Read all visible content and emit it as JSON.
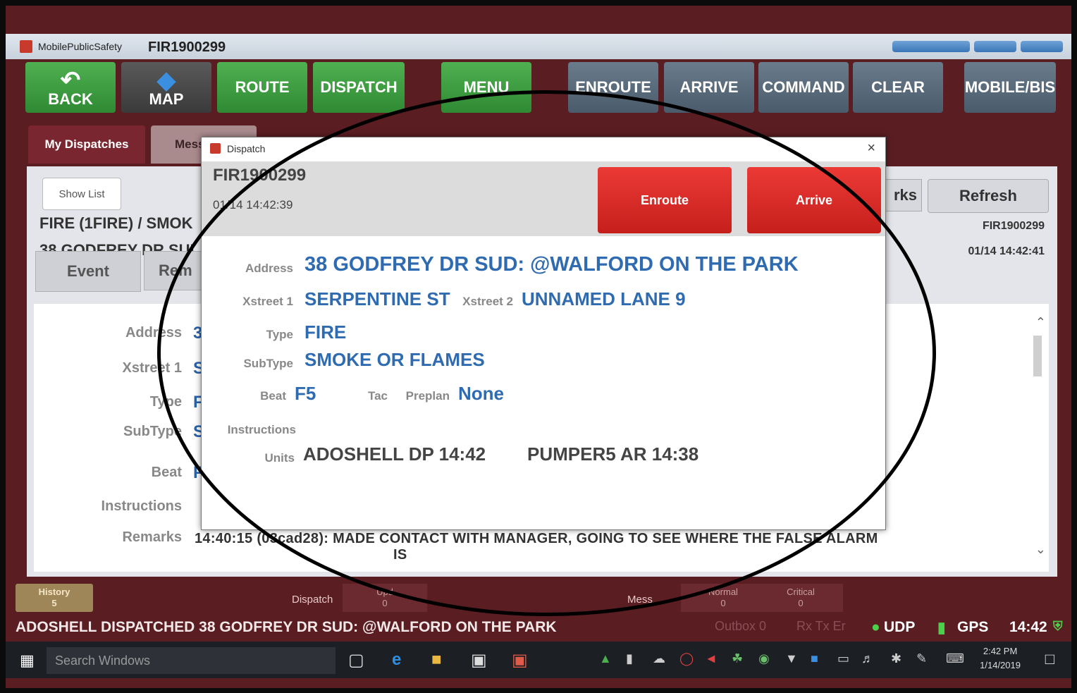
{
  "titlebar": {
    "app_name": "MobilePublicSafety",
    "incident_id": "FIR1900299"
  },
  "toolbar": {
    "back": "BACK",
    "map": "MAP",
    "route": "ROUTE",
    "dispatch": "DISPATCH",
    "menu": "MENU",
    "enroute": "ENROUTE",
    "arrive": "ARRIVE",
    "command": "COMMAND",
    "clear": "CLEAR",
    "mobile": "MOBILE/BIS"
  },
  "tabs": {
    "my_dispatches": "My Dispatches",
    "messages": "Mess"
  },
  "background": {
    "show_list": "Show List",
    "title_line": "FIRE (1FIRE) / SMOK",
    "address_line": "38 GODFREY DR SUI",
    "refresh": "Refresh",
    "rks": "rks",
    "incident_id": "FIR1900299",
    "timestamp": "01/14 14:42:41",
    "subtab_event": "Event",
    "subtab_remarks": "Rem",
    "labels": {
      "address": "Address",
      "xstreet1": "Xstreet 1",
      "type": "Type",
      "subtype": "SubType",
      "beat": "Beat",
      "instructions": "Instructions",
      "remarks": "Remarks"
    },
    "values": {
      "address": "3",
      "xstreet1": "S",
      "type": "F",
      "subtype": "S",
      "beat": "F"
    },
    "remarks_text_1": "14:40:15 (03cad28): MADE CONTACT WITH MANAGER, GOING TO SEE WHERE THE FALSE ALARM",
    "remarks_text_2": "IS"
  },
  "dialog": {
    "title": "Dispatch",
    "close": "×",
    "incident_id": "FIR1900299",
    "timestamp": "01/14 14:42:39",
    "enroute_button": "Enroute",
    "arrive_button": "Arrive",
    "address_label": "Address",
    "address": "38 GODFREY DR SUD: @WALFORD ON THE PARK",
    "xstreet1_label": "Xstreet 1",
    "xstreet1": "SERPENTINE ST",
    "xstreet2_label": "Xstreet 2",
    "xstreet2": "UNNAMED LANE 9",
    "type_label": "Type",
    "type": "FIRE",
    "subtype_label": "SubType",
    "subtype": "SMOKE OR FLAMES",
    "beat_label": "Beat",
    "beat": "F5",
    "tac_label": "Tac",
    "preplan_label": "Preplan",
    "preplan": "None",
    "instructions_label": "Instructions",
    "units_label": "Units",
    "unit1": "ADOSHELL  DP  14:42",
    "unit2": "PUMPER5  AR  14:38"
  },
  "statusbar": {
    "history_label": "History",
    "history_count": "5",
    "dispatch_label": "Dispatch",
    "update_label": "Upd",
    "update_count": "0",
    "messages_label": "Mess",
    "normal_label": "Normal",
    "normal_count": "0",
    "critical_label": "Critical",
    "critical_count": "0",
    "unit_status": "ADOSHELL   DISPATCHED   38 GODFREY DR SUD: @WALFORD ON THE PARK",
    "outbox": "Outbox 0",
    "rx_tx": "Rx  Tx  Er",
    "udp": "UDP",
    "gps": "GPS",
    "time": "14:42"
  },
  "taskbar": {
    "search_placeholder": "Search Windows",
    "time": "2:42 PM",
    "date": "1/14/2019"
  },
  "colors": {
    "accent_green": "#3f9d42",
    "alert_red": "#d92a27",
    "link_blue": "#2f6bb0",
    "frame": "#5a1d22"
  }
}
